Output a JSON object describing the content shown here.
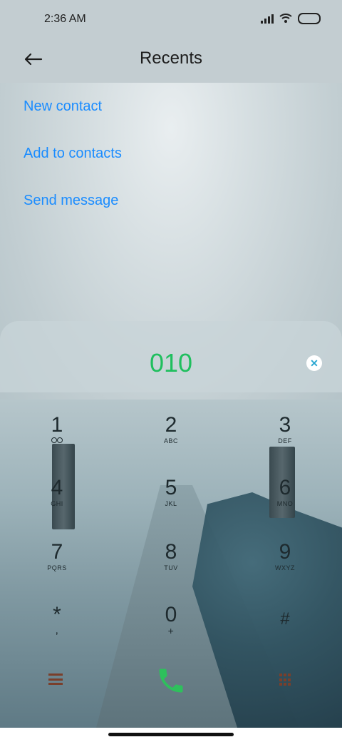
{
  "status_bar": {
    "time": "2:36 AM"
  },
  "header": {
    "title": "Recents"
  },
  "menu": [
    {
      "label": "New contact"
    },
    {
      "label": "Add to contacts"
    },
    {
      "label": "Send message"
    }
  ],
  "dialer": {
    "number": "010",
    "keys": [
      {
        "digit": "1",
        "letters": ""
      },
      {
        "digit": "2",
        "letters": "ABC"
      },
      {
        "digit": "3",
        "letters": "DEF"
      },
      {
        "digit": "4",
        "letters": "GHI"
      },
      {
        "digit": "5",
        "letters": "JKL"
      },
      {
        "digit": "6",
        "letters": "MNO"
      },
      {
        "digit": "7",
        "letters": "PQRS"
      },
      {
        "digit": "8",
        "letters": "TUV"
      },
      {
        "digit": "9",
        "letters": "WXYZ"
      },
      {
        "digit": "*",
        "letters": ","
      },
      {
        "digit": "0",
        "letters": "+"
      },
      {
        "digit": "#",
        "letters": ""
      }
    ]
  },
  "colors": {
    "accent_link": "#1a8cff",
    "number_green": "#1fbf5e",
    "call_green": "#2ec05c"
  },
  "icons": {
    "back": "arrow-left-icon",
    "clear": "close-circle-icon",
    "call": "phone-icon",
    "menu": "hamburger-menu-icon",
    "grid": "dialpad-grid-icon"
  }
}
